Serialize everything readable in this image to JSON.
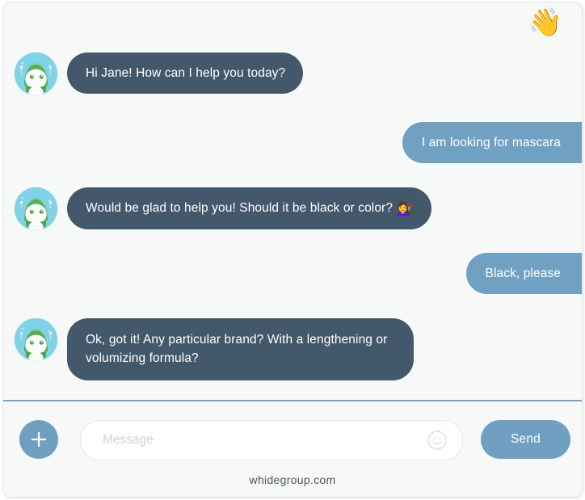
{
  "window": {
    "background_color": "#f7f8f8",
    "accent_user_color": "#71a1c2",
    "accent_bot_color": "#44586b",
    "divider_color": "#7d9fb6"
  },
  "header": {
    "wave_emoji": "👋"
  },
  "conversation": {
    "messages": [
      {
        "sender": "bot",
        "text": "Hi Jane! How can I help you today?",
        "avatar": "robot-avatar"
      },
      {
        "sender": "user",
        "text": "I am looking for mascara"
      },
      {
        "sender": "bot",
        "text": "Would be glad to help you! Should it be black or color? ",
        "emoji": "💇‍♀️",
        "avatar": "robot-avatar"
      },
      {
        "sender": "user",
        "text": "Black, please"
      },
      {
        "sender": "bot",
        "text": "Ok, got it! Any particular brand? With a lengthening or volumizing formula?",
        "avatar": "robot-avatar"
      }
    ]
  },
  "composer": {
    "attach_label": "+",
    "input_value": "",
    "input_placeholder": "Message",
    "emoji_icon": "smiley-icon",
    "send_label": "Send"
  },
  "footer": {
    "site": "whidegroup.com"
  }
}
